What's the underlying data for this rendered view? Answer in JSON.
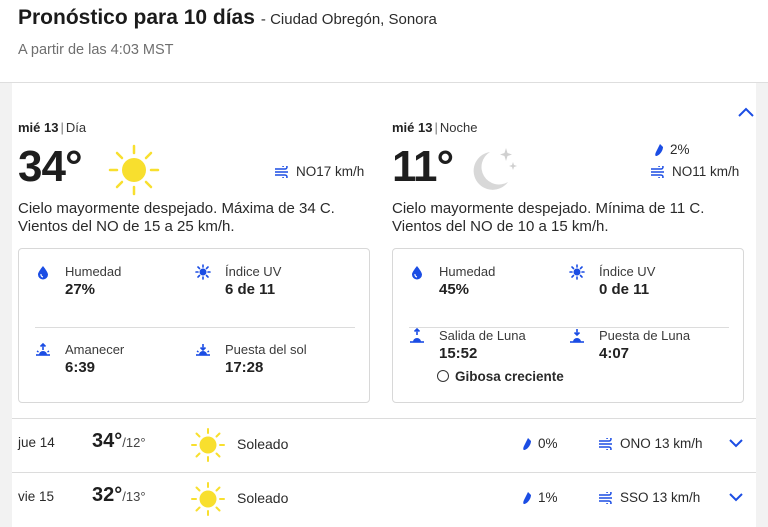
{
  "header": {
    "title": "Pronóstico para 10 días",
    "location": "- Ciudad Obregón, Sonora",
    "as_of": "A partir de las 4:03 MST"
  },
  "day": {
    "date": "mié 13",
    "period": "Día",
    "temp": "34°",
    "icon": "sun-icon",
    "wind": "NO17 km/h",
    "narrative": "Cielo mayormente despejado. Máxima de 34 C. Vientos del NO de 15 a 25 km/h.",
    "humidity_label": "Humedad",
    "humidity": "27%",
    "uv_label": "Índice UV",
    "uv": "6 de 11",
    "sunrise_label": "Amanecer",
    "sunrise": "6:39",
    "sunset_label": "Puesta del sol",
    "sunset": "17:28"
  },
  "night": {
    "date": "mié 13",
    "period": "Noche",
    "temp": "11°",
    "icon": "moon-stars-icon",
    "precip": "2%",
    "wind": "NO11 km/h",
    "narrative": "Cielo mayormente despejado. Mínima de 11 C. Vientos del NO de 10 a 15 km/h.",
    "humidity_label": "Humedad",
    "humidity": "45%",
    "uv_label": "Índice UV",
    "uv": "0 de 11",
    "moonrise_label": "Salida de Luna",
    "moonrise": "15:52",
    "moonset_label": "Puesta de Luna",
    "moonset": "4:07",
    "moon_phase": "Gibosa creciente"
  },
  "rows": [
    {
      "day": "jue 14",
      "hi": "34°",
      "lo": "/12°",
      "condition": "Soleado",
      "precip": "0%",
      "wind": "ONO 13 km/h"
    },
    {
      "day": "vie 15",
      "hi": "32°",
      "lo": "/13°",
      "condition": "Soleado",
      "precip": "1%",
      "wind": "SSO 13 km/h"
    }
  ],
  "colors": {
    "accent": "#1b4de4",
    "sun": "#f8df2e",
    "moon": "#d8d8d8"
  }
}
